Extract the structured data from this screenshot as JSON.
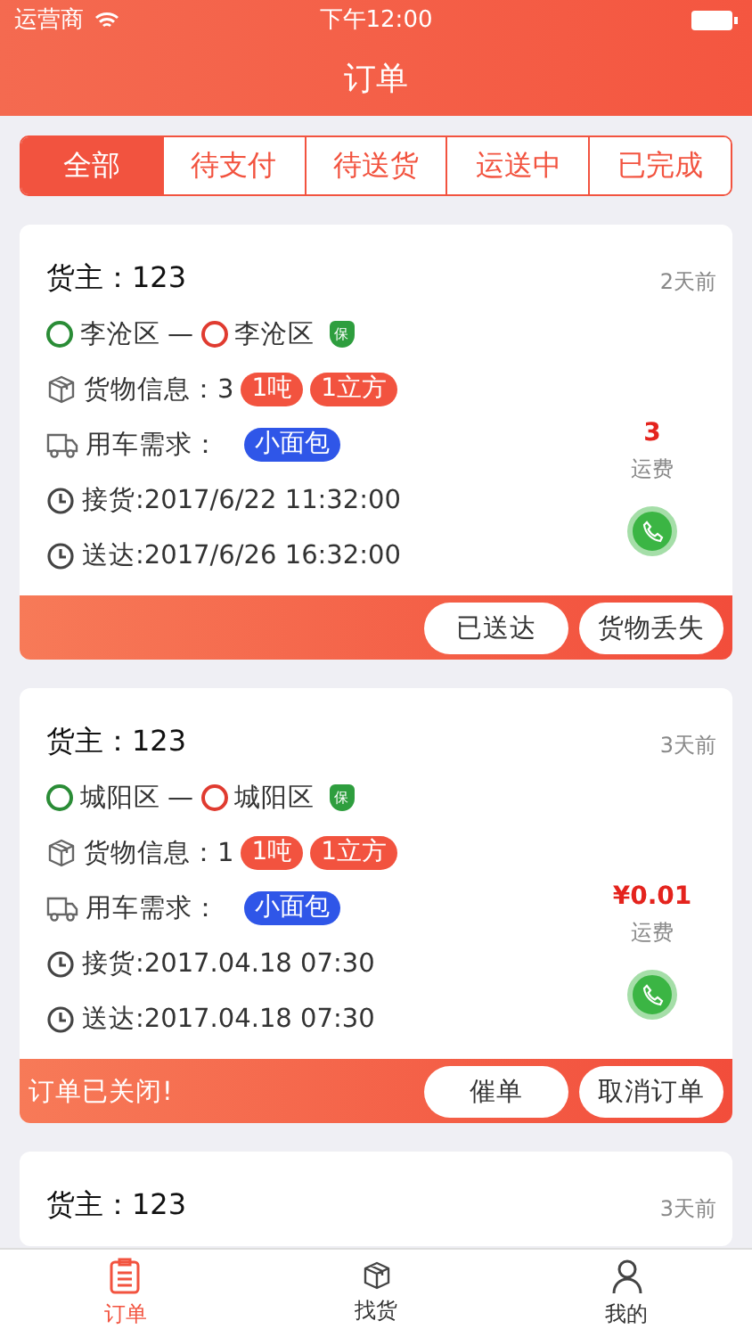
{
  "status_bar": {
    "carrier": "运营商",
    "time": "下午12:00"
  },
  "header": {
    "title": "订单"
  },
  "tabs": [
    {
      "label": "全部",
      "selected": true
    },
    {
      "label": "待支付",
      "selected": false
    },
    {
      "label": "待送货",
      "selected": false
    },
    {
      "label": "运送中",
      "selected": false
    },
    {
      "label": "已完成",
      "selected": false
    }
  ],
  "orders": [
    {
      "owner": "货主：123",
      "time_ago": "2天前",
      "from": "李沧区",
      "separator": "—",
      "to": "李沧区",
      "insured": true,
      "insured_label": "保",
      "goods_label": "货物信息：3",
      "tags": [
        "1吨",
        "1立方"
      ],
      "vehicle_label": "用车需求：",
      "vehicle": "小面包",
      "pickup": "接货:2017/6/22 11:32:00",
      "delivery": "送达:2017/6/26 16:32:00",
      "price": "3",
      "price_label": "运费",
      "buttons": [
        "已送达",
        "货物丢失"
      ]
    },
    {
      "owner": "货主：123",
      "time_ago": "3天前",
      "from": "城阳区",
      "separator": "—",
      "to": "城阳区",
      "insured": true,
      "insured_label": "保",
      "goods_label": "货物信息：1",
      "tags": [
        "1吨",
        "1立方"
      ],
      "vehicle_label": "用车需求：",
      "vehicle": "小面包",
      "pickup": "接货:2017.04.18 07:30",
      "delivery": "送达:2017.04.18 07:30",
      "price": "¥0.01",
      "price_label": "运费",
      "status": "订单已关闭!",
      "buttons": [
        "催单",
        "取消订单"
      ]
    },
    {
      "owner": "货主：123",
      "time_ago": "3天前"
    }
  ],
  "tab_bar": [
    {
      "label": "订单",
      "kind": "orders",
      "selected": true
    },
    {
      "label": "找货",
      "kind": "find",
      "selected": false
    },
    {
      "label": "我的",
      "kind": "profile",
      "selected": false
    }
  ]
}
